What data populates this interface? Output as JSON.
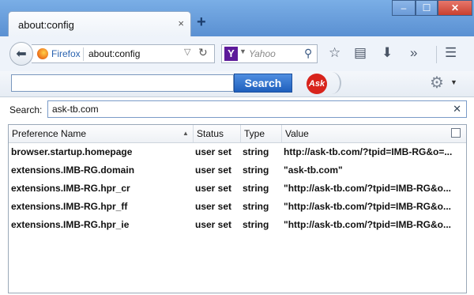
{
  "tab": {
    "title": "about:config",
    "close": "×"
  },
  "new_tab": "+",
  "window_controls": {
    "minimize": "–",
    "maximize": "☐",
    "close": "✕"
  },
  "nav": {
    "back_icon": "back-arrow-icon",
    "identity_label": "Firefox",
    "url": "about:config",
    "reload_icon": "reload-icon",
    "search_engine_logo": "Y",
    "search_placeholder": "Yahoo",
    "toolbar_icons": [
      "bookmark-star-icon",
      "reading-list-icon",
      "download-icon",
      "overflow-chevron-icon",
      "menu-icon"
    ]
  },
  "ask_toolbar": {
    "input_value": "",
    "button_label": "Search",
    "logo_text": "Ask",
    "settings_icon": "gear-icon"
  },
  "config": {
    "search_label": "Search:",
    "filter_value": "ask-tb.com",
    "columns": [
      "Preference Name",
      "Status",
      "Type",
      "Value"
    ],
    "rows": [
      {
        "name": "browser.startup.homepage",
        "status": "user set",
        "type": "string",
        "value": "http://ask-tb.com/?tpid=IMB-RG&o=..."
      },
      {
        "name": "extensions.IMB-RG.domain",
        "status": "user set",
        "type": "string",
        "value": "\"ask-tb.com\""
      },
      {
        "name": "extensions.IMB-RG.hpr_cr",
        "status": "user set",
        "type": "string",
        "value": "\"http://ask-tb.com/?tpid=IMB-RG&o..."
      },
      {
        "name": "extensions.IMB-RG.hpr_ff",
        "status": "user set",
        "type": "string",
        "value": "\"http://ask-tb.com/?tpid=IMB-RG&o..."
      },
      {
        "name": "extensions.IMB-RG.hpr_ie",
        "status": "user set",
        "type": "string",
        "value": "\"http://ask-tb.com/?tpid=IMB-RG&o..."
      }
    ]
  },
  "colors": {
    "window_frame": "#5a8ed0",
    "ask_button": "#1f5fbd",
    "ask_logo": "#d8241c",
    "yahoo": "#5d1a9a"
  }
}
